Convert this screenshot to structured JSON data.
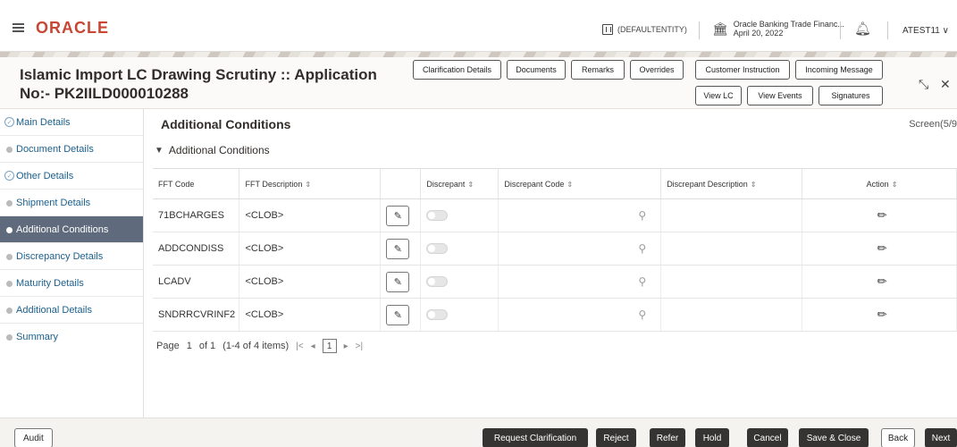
{
  "header": {
    "menu_icon": "hamburger-icon",
    "logo": "ORACLE",
    "entity": "(DEFAULTENTITY)",
    "bank_name": "Oracle Banking Trade Financ...",
    "bank_date": "April 20, 2022",
    "user": "ATEST11 ∨",
    "brand_color": "#c74634"
  },
  "title": {
    "line1": "Islamic Import LC Drawing Scrutiny :: Application",
    "line2": "No:- PK2IILD000010288"
  },
  "header_buttons": {
    "clarification_details": "Clarification Details",
    "documents": "Documents",
    "remarks": "Remarks",
    "overrides": "Overrides",
    "customer_instruction": "Customer Instruction",
    "incoming_message": "Incoming Message",
    "view_lc": "View LC",
    "view_events": "View Events",
    "signatures": "Signatures"
  },
  "sidebar": {
    "items": [
      {
        "label": "Main Details",
        "state": "done"
      },
      {
        "label": "Document Details",
        "state": "pending"
      },
      {
        "label": "Other Details",
        "state": "done"
      },
      {
        "label": "Shipment Details",
        "state": "pending"
      },
      {
        "label": "Additional Conditions",
        "state": "active"
      },
      {
        "label": "Discrepancy Details",
        "state": "pending"
      },
      {
        "label": "Maturity Details",
        "state": "pending"
      },
      {
        "label": "Additional Details",
        "state": "pending"
      },
      {
        "label": "Summary",
        "state": "pending"
      }
    ]
  },
  "main": {
    "section_title": "Additional Conditions",
    "screen_no": "Screen(5/9",
    "sub_title": "Additional Conditions",
    "columns": {
      "fft_code": "FFT Code",
      "fft_description": "FFT Description",
      "discrepant": "Discrepant",
      "discrepant_code": "Discrepant Code",
      "discrepant_description": "Discrepant Description",
      "action": "Action"
    },
    "rows": [
      {
        "code": "71BCHARGES",
        "description": "<CLOB>"
      },
      {
        "code": "ADDCONDISS",
        "description": "<CLOB>"
      },
      {
        "code": "LCADV",
        "description": "<CLOB>"
      },
      {
        "code": "SNDRRCVRINF2",
        "description": "<CLOB>"
      }
    ],
    "pager": {
      "label": "Page",
      "current": "1",
      "of": "of 1",
      "items": "(1-4 of 4 items)",
      "page_box": "1"
    }
  },
  "footer": {
    "audit": "Audit",
    "request_clarification": "Request Clarification",
    "reject": "Reject",
    "refer": "Refer",
    "hold": "Hold",
    "cancel": "Cancel",
    "save_close": "Save & Close",
    "back": "Back",
    "next": "Next"
  }
}
